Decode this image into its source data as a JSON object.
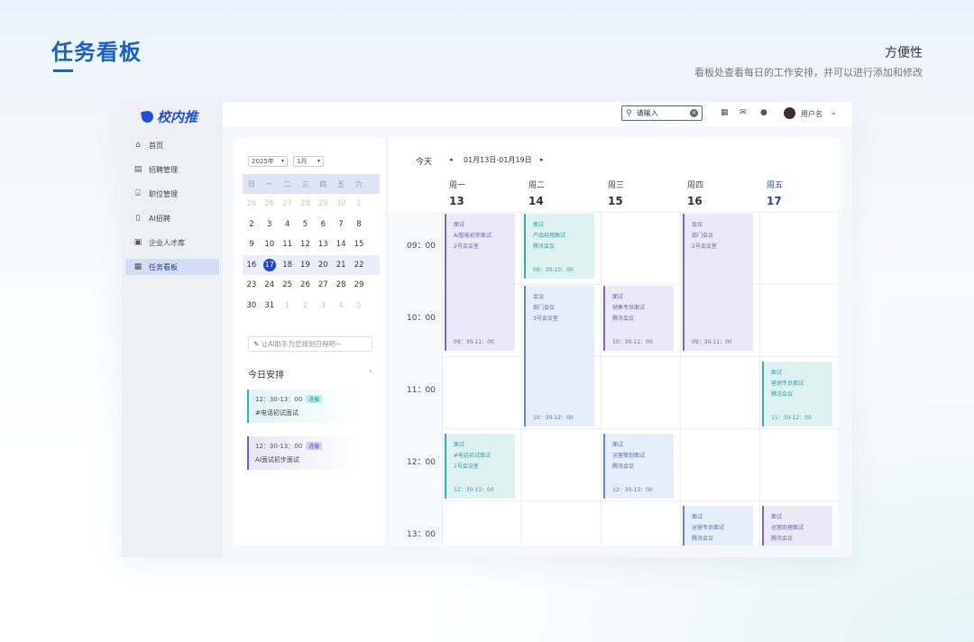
{
  "header": {
    "title": "任务看板",
    "feature_title": "方便性",
    "feature_desc": "看板处查看每日的工作安排，并可以进行添加和修改"
  },
  "app": {
    "logo": "校内推",
    "nav": [
      {
        "label": "首页",
        "icon": "home-icon",
        "active": false
      },
      {
        "label": "招聘管理",
        "icon": "document-icon",
        "active": false
      },
      {
        "label": "职位管理",
        "icon": "building-icon",
        "active": false
      },
      {
        "label": "AI招聘",
        "icon": "ai-doc-icon",
        "active": false
      },
      {
        "label": "企业人才库",
        "icon": "talent-icon",
        "active": false
      },
      {
        "label": "任务看板",
        "icon": "board-icon",
        "active": true
      }
    ],
    "search": {
      "value": "请输入"
    },
    "username": "用户名"
  },
  "mini_calendar": {
    "year_label": "2025年",
    "month_label": "1月",
    "weekdays": [
      "日",
      "一",
      "二",
      "三",
      "四",
      "五",
      "六"
    ],
    "weeks": [
      [
        {
          "d": "26",
          "m": true
        },
        {
          "d": "26",
          "m": true
        },
        {
          "d": "27",
          "m": true
        },
        {
          "d": "28",
          "m": true
        },
        {
          "d": "29",
          "m": true
        },
        {
          "d": "30",
          "m": true
        },
        {
          "d": "1",
          "m": true
        }
      ],
      [
        {
          "d": "2"
        },
        {
          "d": "3"
        },
        {
          "d": "4"
        },
        {
          "d": "5"
        },
        {
          "d": "6"
        },
        {
          "d": "7"
        },
        {
          "d": "8"
        }
      ],
      [
        {
          "d": "9"
        },
        {
          "d": "10"
        },
        {
          "d": "11"
        },
        {
          "d": "12"
        },
        {
          "d": "13"
        },
        {
          "d": "14"
        },
        {
          "d": "15"
        }
      ],
      [
        {
          "d": "16"
        },
        {
          "d": "17",
          "today": true
        },
        {
          "d": "18"
        },
        {
          "d": "19"
        },
        {
          "d": "20"
        },
        {
          "d": "21"
        },
        {
          "d": "22"
        }
      ],
      [
        {
          "d": "23"
        },
        {
          "d": "24"
        },
        {
          "d": "25"
        },
        {
          "d": "26"
        },
        {
          "d": "27"
        },
        {
          "d": "28"
        },
        {
          "d": "29"
        }
      ],
      [
        {
          "d": "30"
        },
        {
          "d": "31"
        },
        {
          "d": "1",
          "m": true
        },
        {
          "d": "2",
          "m": true
        },
        {
          "d": "3",
          "m": true
        },
        {
          "d": "4",
          "m": true
        },
        {
          "d": "5",
          "m": true
        }
      ]
    ],
    "current_week_index": 3
  },
  "ai_input_placeholder": "让AI助手为您规划日程吧~",
  "today_agenda": {
    "title": "今日安排",
    "more": "›",
    "items": [
      {
        "time": "12：30-13：00",
        "tag": "进展",
        "name": "#电话初试面试",
        "color": "teal"
      },
      {
        "time": "12：30-13：00",
        "tag": "进展",
        "name": "AI面试初步面试",
        "color": "purple"
      }
    ]
  },
  "week": {
    "today_label": "今天",
    "prev": "◂",
    "next": "▸",
    "range": "01月13日-01月19日",
    "days": [
      {
        "name": "周一",
        "date": "13",
        "today": false
      },
      {
        "name": "周二",
        "date": "14",
        "today": false
      },
      {
        "name": "周三",
        "date": "15",
        "today": false
      },
      {
        "name": "周四",
        "date": "16",
        "today": false
      },
      {
        "name": "周五",
        "date": "17",
        "today": true
      }
    ],
    "hours": [
      "09：00",
      "10：00",
      "11：00",
      "12：00",
      "13：00"
    ],
    "events": [
      {
        "day": 0,
        "start": 9.0,
        "end": 10.9,
        "color": "purple",
        "lines": [
          "面试",
          "AI智能初步面试",
          "2号会议室"
        ],
        "time": "09：30-11：00"
      },
      {
        "day": 1,
        "start": 9.0,
        "end": 9.9,
        "color": "teal",
        "lines": [
          "面试",
          "产品经理面试",
          "腾讯会议"
        ],
        "time": "09：30-10：00"
      },
      {
        "day": 1,
        "start": 10.0,
        "end": 11.95,
        "color": "blue",
        "lines": [
          "会议",
          "部门会议",
          "3号会议室"
        ],
        "time": "10：30-12：00"
      },
      {
        "day": 2,
        "start": 10.0,
        "end": 10.9,
        "color": "purple",
        "lines": [
          "面试",
          "销售专员面试",
          "腾讯会议"
        ],
        "time": "10：30-11：00"
      },
      {
        "day": 3,
        "start": 9.0,
        "end": 10.9,
        "color": "purple",
        "lines": [
          "会议",
          "部门会议",
          "2号会议室"
        ],
        "time": "09：30-11：00"
      },
      {
        "day": 4,
        "start": 11.05,
        "end": 11.95,
        "color": "teal",
        "lines": [
          "面试",
          "营销专员面试",
          "腾讯会议"
        ],
        "time": "11：30-12：00"
      },
      {
        "day": 0,
        "start": 12.05,
        "end": 12.95,
        "color": "teal",
        "lines": [
          "面试",
          "#电话初试面试",
          "1号会议室"
        ],
        "time": "12：30-13：00"
      },
      {
        "day": 2,
        "start": 12.05,
        "end": 12.95,
        "color": "blue",
        "lines": [
          "面试",
          "运营策划面试",
          "腾讯会议"
        ],
        "time": "12：30-13：00"
      },
      {
        "day": 3,
        "start": 13.05,
        "end": 13.6,
        "color": "blue",
        "lines": [
          "面试",
          "运营专员面试",
          "腾讯会议"
        ],
        "time": ""
      },
      {
        "day": 4,
        "start": 13.05,
        "end": 13.6,
        "color": "purple",
        "lines": [
          "面试",
          "运营助理面试",
          "腾讯会议"
        ],
        "time": ""
      }
    ]
  }
}
